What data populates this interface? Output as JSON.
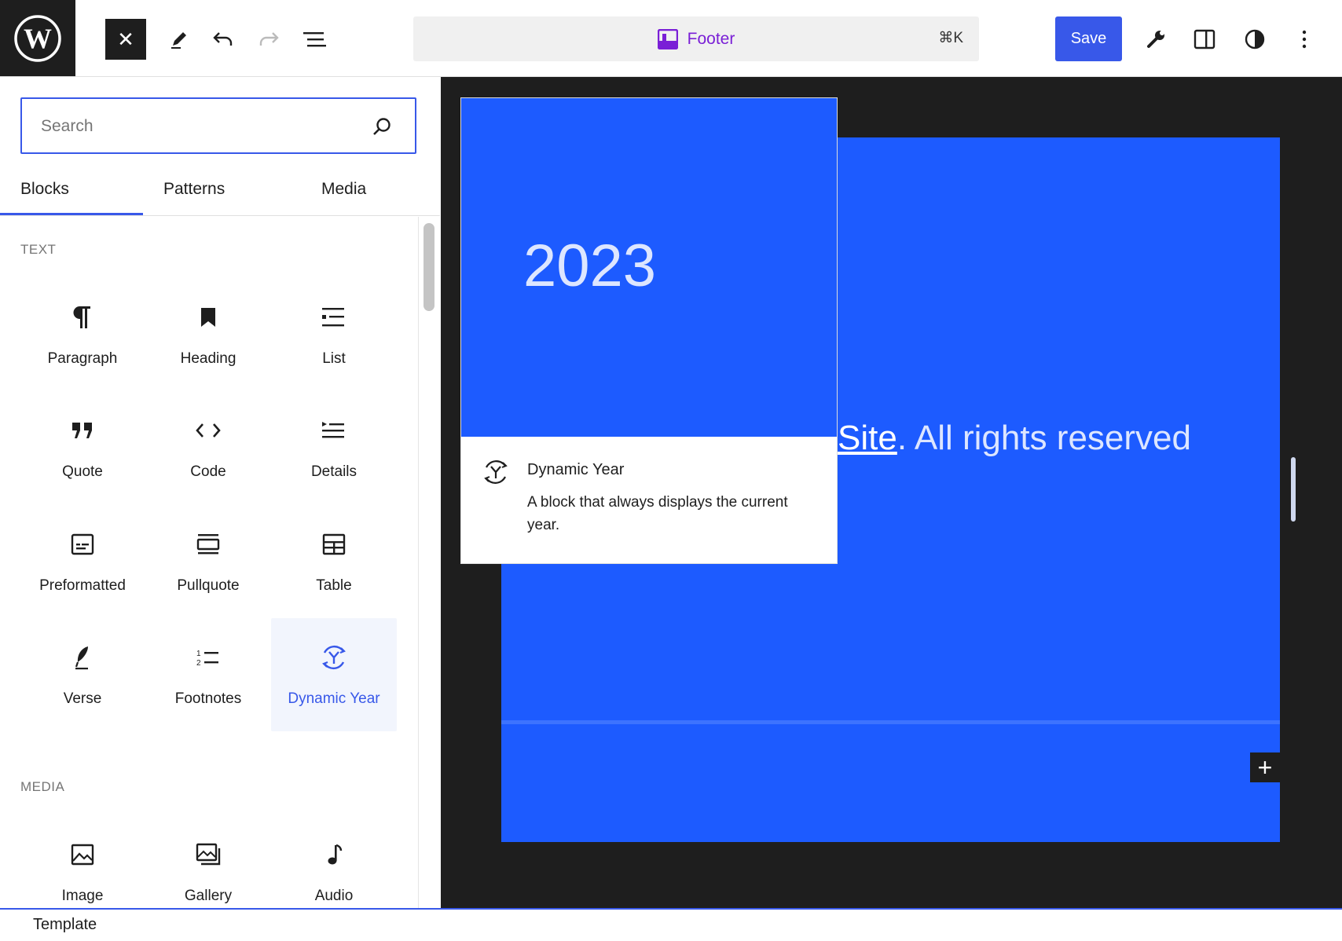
{
  "topbar": {
    "command_title": "Footer",
    "command_shortcut": "⌘K",
    "save_label": "Save"
  },
  "sidebar": {
    "search": {
      "placeholder": "Search",
      "value": ""
    },
    "tabs": [
      {
        "label": "Blocks",
        "active": true
      },
      {
        "label": "Patterns",
        "active": false
      },
      {
        "label": "Media",
        "active": false
      }
    ],
    "sections": [
      {
        "label": "TEXT",
        "items": [
          {
            "label": "Paragraph",
            "icon": "paragraph-icon"
          },
          {
            "label": "Heading",
            "icon": "heading-icon"
          },
          {
            "label": "List",
            "icon": "list-icon"
          },
          {
            "label": "Quote",
            "icon": "quote-icon"
          },
          {
            "label": "Code",
            "icon": "code-icon"
          },
          {
            "label": "Details",
            "icon": "details-icon"
          },
          {
            "label": "Preformatted",
            "icon": "preformatted-icon"
          },
          {
            "label": "Pullquote",
            "icon": "pullquote-icon"
          },
          {
            "label": "Table",
            "icon": "table-icon"
          },
          {
            "label": "Verse",
            "icon": "verse-icon"
          },
          {
            "label": "Footnotes",
            "icon": "footnotes-icon"
          },
          {
            "label": "Dynamic Year",
            "icon": "dynamic-year-icon",
            "selected": true
          }
        ]
      },
      {
        "label": "MEDIA",
        "items": [
          {
            "label": "Image",
            "icon": "image-icon"
          },
          {
            "label": "Gallery",
            "icon": "gallery-icon"
          },
          {
            "label": "Audio",
            "icon": "audio-icon"
          }
        ]
      }
    ]
  },
  "canvas": {
    "footer_link": "Site",
    "footer_rest": ". All rights reserved"
  },
  "preview": {
    "year": "2023",
    "title": "Dynamic Year",
    "description": "A block that always displays the current year."
  },
  "bottombar": {
    "label": "Template"
  },
  "colors": {
    "accent": "#3858e9",
    "footer_blue": "#1d5bff",
    "canvas_bg": "#1e1e1e",
    "site_title_purple": "#7a1fd6"
  }
}
